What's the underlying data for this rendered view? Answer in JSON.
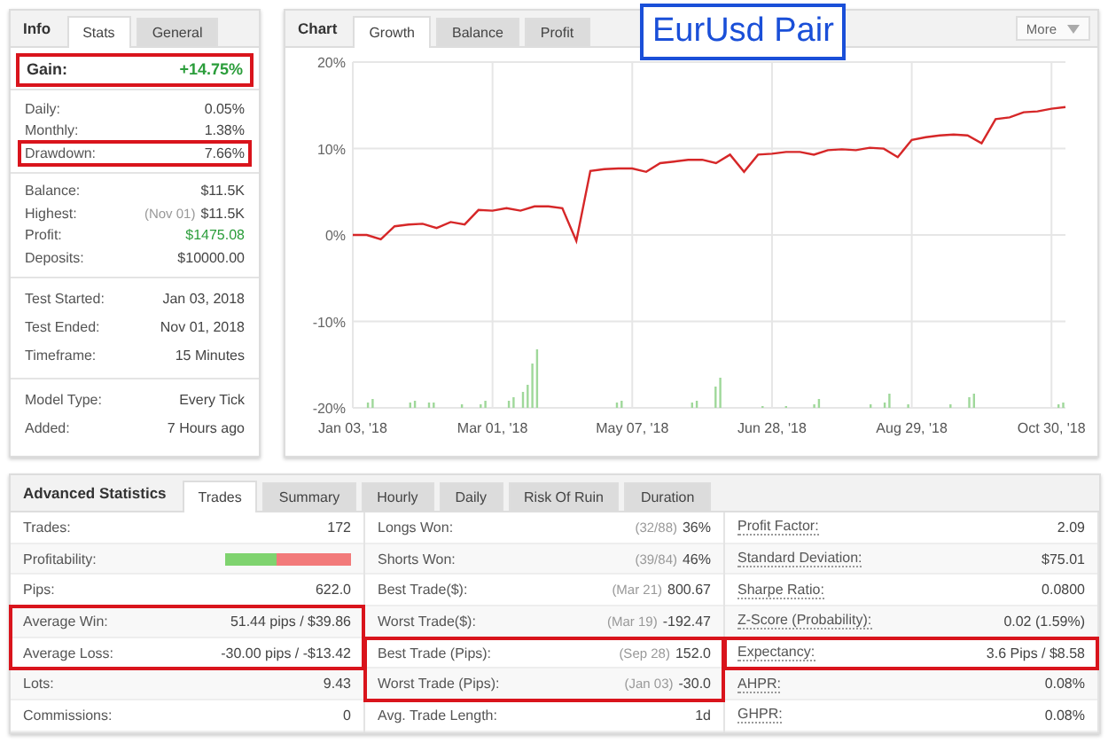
{
  "info": {
    "title": "Info",
    "tabs": [
      {
        "label": "Stats",
        "selected": true
      },
      {
        "label": "General",
        "selected": false
      }
    ],
    "gain": {
      "label": "Gain:",
      "value": "+14.75%",
      "highlighted": true
    },
    "sections": [
      [
        {
          "label": "Daily:",
          "value": "0.05%",
          "highlighted": false
        },
        {
          "label": "Monthly:",
          "value": "1.38%",
          "highlighted": false
        },
        {
          "label": "Drawdown:",
          "value": "7.66%",
          "highlighted": true
        }
      ],
      [
        {
          "label": "Balance:",
          "value": "$11.5K",
          "highlighted": false
        },
        {
          "label": "Highest:",
          "note": "(Nov 01)",
          "value": "$11.5K",
          "highlighted": false
        },
        {
          "label": "Profit:",
          "value": "$1475.08",
          "color": "#2a9d3a",
          "highlighted": false
        },
        {
          "label": "Deposits:",
          "value": "$10000.00",
          "highlighted": false
        }
      ],
      [
        {
          "label": "Test Started:",
          "value": "Jan 03, 2018",
          "highlighted": false
        },
        {
          "label": "Test Ended:",
          "value": "Nov 01, 2018",
          "highlighted": false
        },
        {
          "label": "Timeframe:",
          "value": "15 Minutes",
          "highlighted": false
        }
      ],
      [
        {
          "label": "Model Type:",
          "value": "Every Tick",
          "highlighted": false
        },
        {
          "label": "Added:",
          "value": "7 Hours ago",
          "highlighted": false
        }
      ]
    ]
  },
  "chart": {
    "title": "Chart",
    "tabs": [
      {
        "label": "Growth",
        "selected": true
      },
      {
        "label": "Balance",
        "selected": false
      },
      {
        "label": "Profit",
        "selected": false
      }
    ],
    "annotation": "EurUsd Pair",
    "more_button": "More",
    "chart_data": {
      "type": "line",
      "grid": true,
      "ylim": [
        -20,
        20
      ],
      "yticks": [
        {
          "value": 20,
          "label": "20%"
        },
        {
          "value": 10,
          "label": "10%"
        },
        {
          "value": 0,
          "label": "0%"
        },
        {
          "value": -10,
          "label": "-10%"
        },
        {
          "value": -20,
          "label": "-20%"
        }
      ],
      "categories": [
        "Jan 03, '18",
        null,
        null,
        null,
        null,
        null,
        null,
        null,
        null,
        null,
        "Mar 01, '18",
        null,
        null,
        null,
        null,
        null,
        null,
        null,
        null,
        null,
        "May 07, '18",
        null,
        null,
        null,
        null,
        null,
        null,
        null,
        null,
        null,
        "Jun 28, '18",
        null,
        null,
        null,
        null,
        null,
        null,
        null,
        null,
        null,
        "Aug 29, '18",
        null,
        null,
        null,
        null,
        null,
        null,
        null,
        null,
        null,
        "Oct 30, '18",
        null
      ],
      "series": [
        {
          "color": "#d62728",
          "values": [
            0,
            0,
            -0.5,
            1,
            1.2,
            1.3,
            0.8,
            1.5,
            1.2,
            2.9,
            2.8,
            3.1,
            2.8,
            3.3,
            3.3,
            3.1,
            -0.7,
            7.4,
            7.6,
            7.7,
            7.7,
            7.3,
            8.3,
            8.5,
            8.7,
            8.7,
            8.3,
            9.3,
            7.3,
            9.3,
            9.4,
            9.6,
            9.6,
            9.3,
            9.8,
            9.9,
            9.8,
            10.1,
            10,
            9,
            11,
            11.3,
            11.5,
            11.6,
            11.5,
            10.6,
            13.4,
            13.6,
            14.2,
            14.3,
            14.6,
            14.8
          ]
        }
      ]
    }
  },
  "advanced": {
    "title": "Advanced Statistics",
    "tabs": [
      {
        "label": "Trades",
        "selected": true
      },
      {
        "label": "Summary",
        "selected": false
      },
      {
        "label": "Hourly",
        "selected": false
      },
      {
        "label": "Daily",
        "selected": false
      },
      {
        "label": "Risk Of Ruin",
        "selected": false
      },
      {
        "label": "Duration",
        "selected": false
      }
    ],
    "columns": [
      [
        {
          "kind": "text",
          "label": "Trades:",
          "value": "172",
          "highlighted": false
        },
        {
          "kind": "bar",
          "label": "Profitability:",
          "level": 0.41,
          "highlighted": false
        },
        {
          "kind": "text",
          "label": "Pips:",
          "value": "622.0",
          "highlighted": false
        },
        {
          "kind": "text",
          "label": "Average Win:",
          "value": "51.44 pips / $39.86",
          "highlighted": true
        },
        {
          "kind": "text",
          "label": "Average Loss:",
          "value": "-30.00 pips / -$13.42",
          "highlighted": true
        },
        {
          "kind": "text",
          "label": "Lots:",
          "value": "9.43",
          "highlighted": false
        },
        {
          "kind": "text",
          "label": "Commissions:",
          "value": "0",
          "highlighted": false
        }
      ],
      [
        {
          "kind": "text",
          "label": "Longs Won:",
          "note": "(32/88)",
          "value": "36%",
          "highlighted": false
        },
        {
          "kind": "text",
          "label": "Shorts Won:",
          "note": "(39/84)",
          "value": "46%",
          "highlighted": false
        },
        {
          "kind": "text",
          "label": "Best Trade($):",
          "note": "(Mar 21)",
          "value": "800.67",
          "highlighted": false
        },
        {
          "kind": "text",
          "label": "Worst Trade($):",
          "note": "(Mar 19)",
          "value": "-192.47",
          "highlighted": false
        },
        {
          "kind": "text",
          "label": "Best Trade (Pips):",
          "note": "(Sep 28)",
          "value": "152.0",
          "highlighted": true
        },
        {
          "kind": "text",
          "label": "Worst Trade (Pips):",
          "note": "(Jan 03)",
          "value": "-30.0",
          "highlighted": true
        },
        {
          "kind": "text",
          "label": "Avg. Trade Length:",
          "value": "1d",
          "highlighted": false
        }
      ],
      [
        {
          "kind": "text",
          "label": "Profit Factor:",
          "value": "2.09",
          "highlighted": false
        },
        {
          "kind": "text",
          "label": "Standard Deviation:",
          "value": "$75.01",
          "highlighted": false
        },
        {
          "kind": "text",
          "label": "Sharpe Ratio:",
          "value": "0.0800",
          "highlighted": false
        },
        {
          "kind": "text",
          "label": "Z-Score (Probability):",
          "value": "0.02 (1.59%)",
          "highlighted": false
        },
        {
          "kind": "text",
          "label": "Expectancy:",
          "value": "3.6 Pips / $8.58",
          "highlighted": true
        },
        {
          "kind": "text",
          "label": "AHPR:",
          "value": "0.08%",
          "highlighted": false
        },
        {
          "kind": "text",
          "label": "GHPR:",
          "value": "0.08%",
          "highlighted": false
        }
      ]
    ]
  }
}
